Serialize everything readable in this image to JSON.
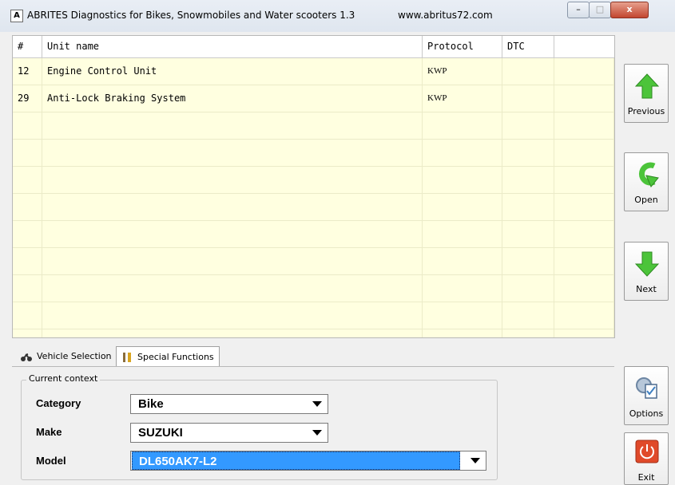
{
  "window": {
    "app_icon": "A",
    "title": "ABRITES Diagnostics for Bikes, Snowmobiles and Water scooters 1.3",
    "url": "www.abritus72.com",
    "buttons": {
      "minimize": "–",
      "maximize": "□",
      "close": "x"
    }
  },
  "grid": {
    "columns": [
      "#",
      "Unit name",
      "Protocol",
      "DTC",
      ""
    ],
    "rows": [
      {
        "num": "12",
        "name": "Engine Control Unit",
        "protocol": "KWP",
        "dtc": ""
      },
      {
        "num": "29",
        "name": "Anti-Lock Braking System",
        "protocol": "KWP",
        "dtc": ""
      }
    ]
  },
  "side_buttons": {
    "previous": "Previous",
    "open": "Open",
    "next": "Next",
    "options": "Options",
    "exit": "Exit"
  },
  "tabs": {
    "vehicle_selection": "Vehicle Selection",
    "special_functions": "Special Functions"
  },
  "context": {
    "legend": "Current context",
    "category_label": "Category",
    "category_value": "Bike",
    "make_label": "Make",
    "make_value": "SUZUKI",
    "model_label": "Model",
    "model_value": "DL650AK7-L2"
  },
  "colors": {
    "grid_bg": "#ffffe0",
    "arrow_green": "#4cc43a",
    "selection_blue": "#3399ff",
    "exit_red": "#e04a2a"
  },
  "icons": [
    "up-arrow-icon",
    "redo-arrow-icon",
    "down-arrow-icon",
    "options-icon",
    "power-icon",
    "motorbike-icon",
    "tools-icon"
  ]
}
